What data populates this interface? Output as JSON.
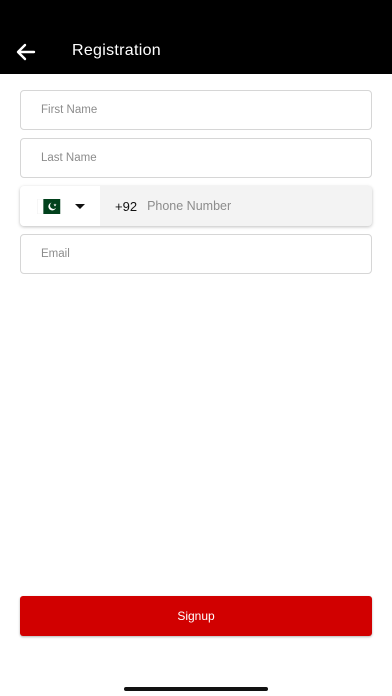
{
  "header": {
    "title": "Registration",
    "back_icon": "arrow-left-icon",
    "background": "#000000"
  },
  "form": {
    "first_name_placeholder": "First Name",
    "last_name_placeholder": "Last Name",
    "phone": {
      "country_flag": "pakistan-flag-icon",
      "dropdown_icon": "caret-down-icon",
      "dial_code": "+92",
      "placeholder": "Phone Number"
    },
    "email_placeholder": "Email"
  },
  "actions": {
    "signup_label": "Signup",
    "accent_color": "#d10000"
  }
}
